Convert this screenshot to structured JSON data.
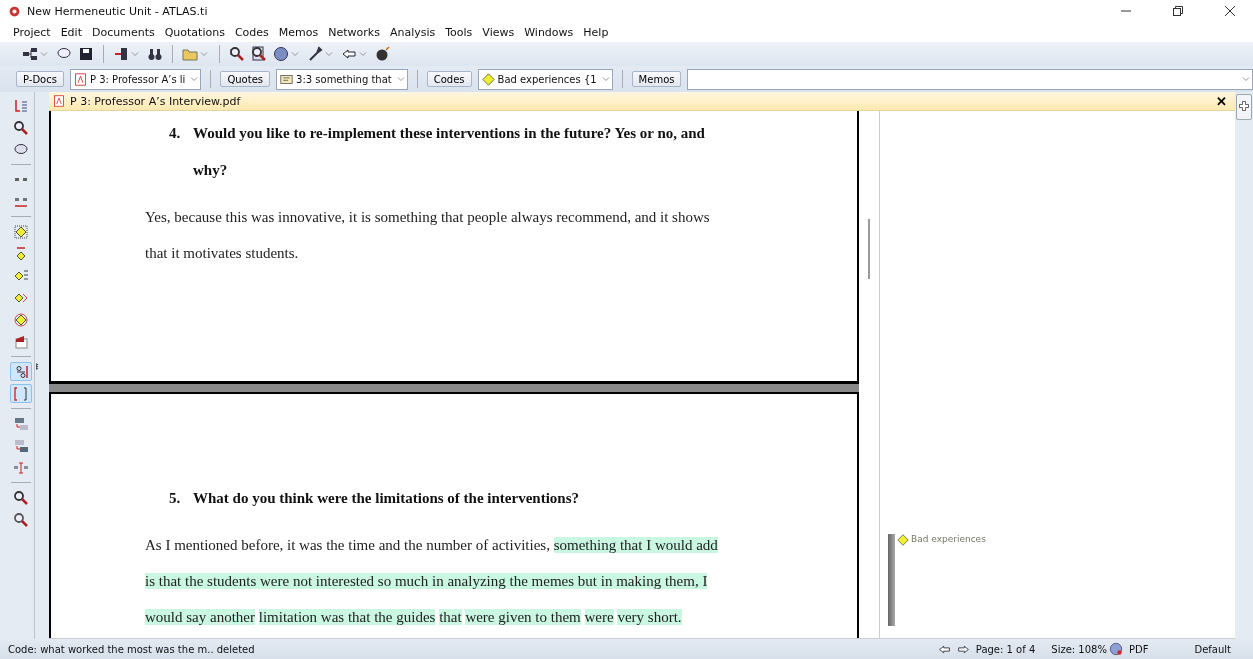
{
  "window": {
    "title": "New Hermeneutic Unit - ATLAS.ti"
  },
  "menu": [
    "Project",
    "Edit",
    "Documents",
    "Quotations",
    "Codes",
    "Memos",
    "Networks",
    "Analysis",
    "Tools",
    "Views",
    "Windows",
    "Help"
  ],
  "navigator": [
    {
      "button": "P-Docs",
      "value": "P 3: Professor A’s li",
      "kind": "pdf"
    },
    {
      "button": "Quotes",
      "value": "3:3 something that",
      "kind": "quote"
    },
    {
      "button": "Codes",
      "value": "Bad experiences {1",
      "kind": "code"
    },
    {
      "button": "Memos",
      "kind": "memo"
    }
  ],
  "document": {
    "title": "P 3: Professor A’s Interview.pdf",
    "close": "✕"
  },
  "left_toolbar": [
    {
      "kind": "margin",
      "selected": false
    },
    {
      "kind": "search",
      "selected": false
    },
    {
      "kind": "comment",
      "selected": false
    },
    {
      "kind": "sep"
    },
    {
      "kind": "quote",
      "selected": false
    },
    {
      "kind": "quote-resize",
      "selected": false
    },
    {
      "kind": "sep"
    },
    {
      "kind": "code-open",
      "selected": false
    },
    {
      "kind": "code-in-vivo",
      "selected": false
    },
    {
      "kind": "code-list",
      "selected": false
    },
    {
      "kind": "code-quick",
      "selected": false
    },
    {
      "kind": "code-unlink",
      "selected": false
    },
    {
      "kind": "memo",
      "selected": false
    },
    {
      "kind": "sep"
    },
    {
      "kind": "number",
      "selected": true
    },
    {
      "kind": "bracket",
      "selected": true
    },
    {
      "kind": "sep"
    },
    {
      "kind": "window-a",
      "selected": false
    },
    {
      "kind": "window-b",
      "selected": false
    },
    {
      "kind": "quote-mark",
      "selected": false
    },
    {
      "kind": "sep"
    },
    {
      "kind": "zoom-in",
      "selected": false
    },
    {
      "kind": "zoom-out",
      "selected": false
    }
  ],
  "pages": [
    {
      "question": {
        "number": "4.",
        "text": "Would you like to re-implement these interventions in the future? Yes or no, and why?"
      },
      "answer": [
        {
          "text": "Yes, because this was innovative, it is something that people always recommend, and it shows that it motivates students.",
          "highlighted": false
        }
      ]
    },
    {
      "question": {
        "number": "5.",
        "text": "What do you think were the limitations of the interventions?"
      },
      "answer": [
        {
          "text": "As I mentioned before, it was the time and the number of activities,",
          "highlighted": false
        },
        {
          "text": "something that I would add is that the students were not interested so much in analyzing the memes but in making them, I would say another",
          "highlighted": true
        },
        {
          "text": "limitation was that the guides",
          "highlighted": true
        },
        {
          "text": "that",
          "highlighted": true
        },
        {
          "text": "were given to them",
          "highlighted": true
        },
        {
          "text": "were",
          "highlighted": true
        },
        {
          "text": "very short.",
          "highlighted": true
        }
      ]
    }
  ],
  "margin_codes": [
    {
      "label": "Bad experiences"
    }
  ],
  "status_bar": {
    "message": "Code: what worked the most was the m.. deleted",
    "page": "Page: 1 of 4",
    "size": "Size: 108%",
    "format": "PDF",
    "layout": "Default"
  }
}
